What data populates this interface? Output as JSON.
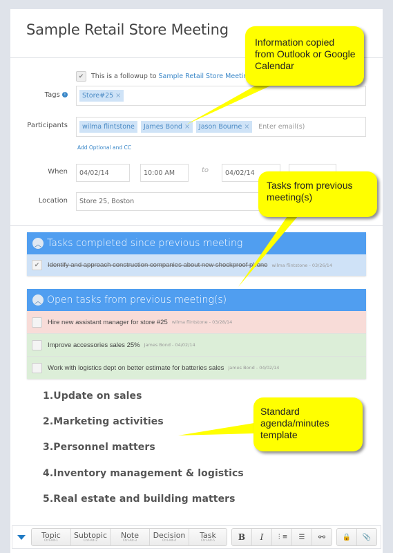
{
  "meeting": {
    "title": "Sample Retail Store Meeting",
    "followup_prefix": "This is a followup to",
    "followup_link": "Sample Retail Store Meeting",
    "followup_checked": true
  },
  "form": {
    "tags_label": "Tags",
    "tags": [
      {
        "label": "Store#25",
        "remove": "×"
      }
    ],
    "participants_label": "Participants",
    "participants": [
      {
        "label": "wilma flintstone",
        "remove": ""
      },
      {
        "label": "James Bond",
        "remove": "×"
      },
      {
        "label": "Jason Bourne",
        "remove": "×"
      }
    ],
    "participants_placeholder": "Enter email(s)",
    "add_optional_label": "Add Optional and CC",
    "when_label": "When",
    "start_date": "04/02/14",
    "start_time": "10:00 AM",
    "to_label": "to",
    "end_date": "04/02/14",
    "end_time": "",
    "location_label": "Location",
    "location": "Store 25, Boston"
  },
  "completed_panel": {
    "title": "Tasks completed since previous meeting",
    "tasks": [
      {
        "text": "Identify and approach construction companies about new shockproof phone",
        "meta": "wilma flintstone - 03/26/14",
        "checked": true
      }
    ]
  },
  "open_panel": {
    "title": "Open tasks from previous meeting(s)",
    "tasks": [
      {
        "text": "Hire new assistant manager for store #25",
        "meta": "wilma flintstone - 03/28/14",
        "status": "overdue",
        "color": "#f8dcd8"
      },
      {
        "text": "Improve accessories sales 25%",
        "meta": "James Bond - 04/02/14",
        "status": "ok",
        "color": "#dceed8"
      },
      {
        "text": "Work with logistics dept on better estimate for batteries sales",
        "meta": "James Bond - 04/02/14",
        "status": "ok",
        "color": "#dceed8"
      }
    ]
  },
  "agenda": [
    "1.Update on sales",
    "2.Marketing activities",
    "3.Personnel matters",
    "4.Inventory management & logistics",
    "5.Real estate and building matters"
  ],
  "toolbar": {
    "collapse_icon": "triangle-down-icon",
    "insert_buttons": [
      {
        "label": "Topic",
        "shortcut": "Ctrl-Alt-1"
      },
      {
        "label": "Subtopic",
        "shortcut": "Ctrl-Alt-2"
      },
      {
        "label": "Note",
        "shortcut": "Ctrl-Alt-3"
      },
      {
        "label": "Decision",
        "shortcut": "Ctrl-Alt-4"
      },
      {
        "label": "Task",
        "shortcut": "Ctrl-Alt-5"
      }
    ],
    "format_buttons": [
      {
        "glyph": "B",
        "icon": "bold-icon"
      },
      {
        "glyph": "I",
        "icon": "italic-icon"
      },
      {
        "glyph": "⋮≡",
        "icon": "ordered-list-icon"
      },
      {
        "glyph": "☰",
        "icon": "unordered-list-icon"
      },
      {
        "glyph": "⚯",
        "icon": "link-icon"
      }
    ],
    "extra_buttons": [
      {
        "glyph": "🔒",
        "icon": "lock-icon"
      },
      {
        "glyph": "📎",
        "icon": "paperclip-icon"
      }
    ]
  },
  "callouts": [
    {
      "text": "Information copied from Outlook or Google Calendar"
    },
    {
      "text": "Tasks from previous meeting(s)"
    },
    {
      "text": "Standard agenda/minutes template"
    }
  ],
  "colors": {
    "accent": "#509ef0",
    "link": "#3a87c8",
    "callout": "#ffff00",
    "completed_row": "#cfe2f7",
    "overdue_row": "#f8dcd8",
    "ok_row": "#dceed8"
  }
}
